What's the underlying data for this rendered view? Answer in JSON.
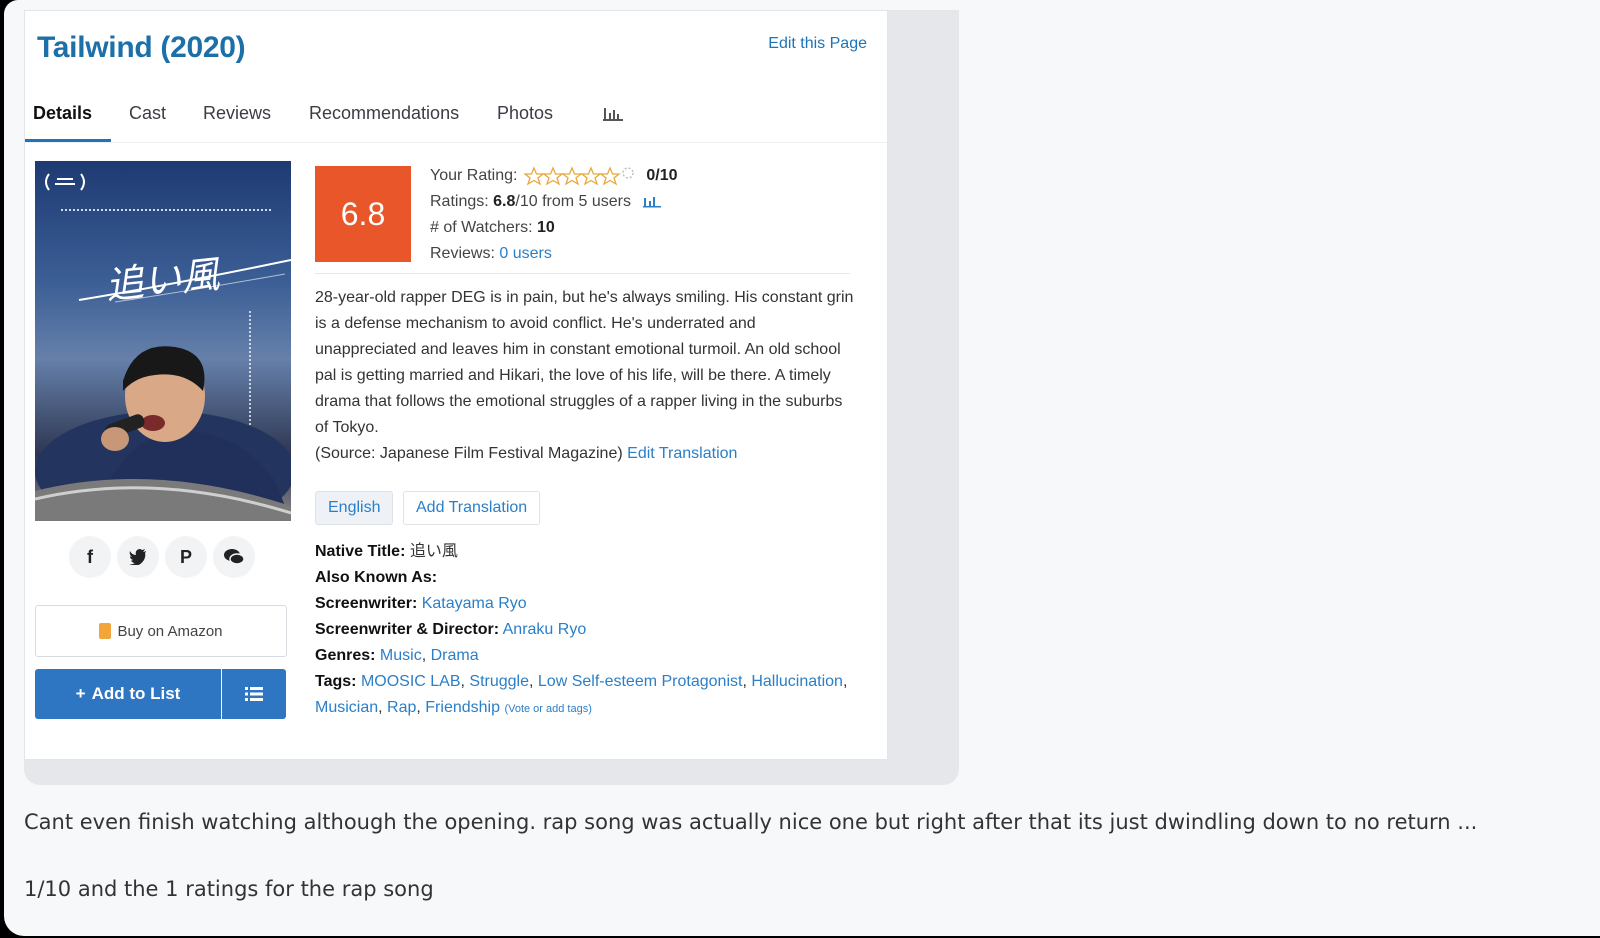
{
  "page": {
    "title": "Tailwind (2020)",
    "edit_link": "Edit this Page"
  },
  "tabs": [
    {
      "label": "Details",
      "active": true
    },
    {
      "label": "Cast"
    },
    {
      "label": "Reviews"
    },
    {
      "label": "Recommendations"
    },
    {
      "label": "Photos"
    },
    {
      "label": "",
      "icon": "bar-chart-icon"
    }
  ],
  "poster": {
    "japanese_title": "追い風",
    "description_icon": "movie-poster"
  },
  "share": {
    "icons": [
      "facebook-icon",
      "twitter-icon",
      "pinterest-icon",
      "chat-icon"
    ],
    "glyphs": [
      "f",
      "🐦",
      "P",
      "💬"
    ]
  },
  "buttons": {
    "amazon": "Buy on Amazon",
    "add_to_list": "Add to List"
  },
  "rating": {
    "score": "6.8",
    "your_rating_label": "Your Rating:",
    "your_rating_value": "0/10",
    "ratings_label": "Ratings:",
    "ratings_value": "6.8",
    "ratings_rest": "/10 from 5 users",
    "watchers_label": "# of Watchers:",
    "watchers_value": "10",
    "reviews_label": "Reviews:",
    "reviews_value": "0 users"
  },
  "synopsis": {
    "text": "28-year-old rapper DEG is in pain, but he's always smiling. His constant grin is a defense mechanism to avoid conflict. He's underrated and unappreciated and leaves him in constant emotional turmoil. An old school pal is getting married and Hikari, the love of his life, will be there. A timely drama that follows the emotional struggles of a rapper living in the suburbs of Tokyo.",
    "source": "(Source: Japanese Film Festival Magazine)",
    "edit_translation": "Edit Translation"
  },
  "languages": {
    "current": "English",
    "add": "Add Translation"
  },
  "details": {
    "native_title_label": "Native Title:",
    "native_title": "追い風",
    "aka_label": "Also Known As:",
    "screenwriter_label": "Screenwriter:",
    "screenwriter": "Katayama Ryo",
    "director_label": "Screenwriter & Director:",
    "director": "Anraku Ryo",
    "genres_label": "Genres:",
    "genres": [
      "Music",
      "Drama"
    ],
    "tags_label": "Tags:",
    "tags": [
      "MOOSIC LAB",
      "Struggle",
      "Low Self-esteem Protagonist",
      "Hallucination",
      "Musician",
      "Rap",
      "Friendship"
    ],
    "vote_tags": "(Vote or add tags)"
  },
  "comment": {
    "line1": "Cant even finish watching although the opening. rap song was actually nice one but right after that its just dwindling down to no return ...",
    "line2": "1/10 and the 1 ratings for the rap song"
  },
  "colors": {
    "accent_blue": "#2f76c2",
    "score_orange": "#e9562a",
    "title_blue": "#1d6fa8"
  }
}
